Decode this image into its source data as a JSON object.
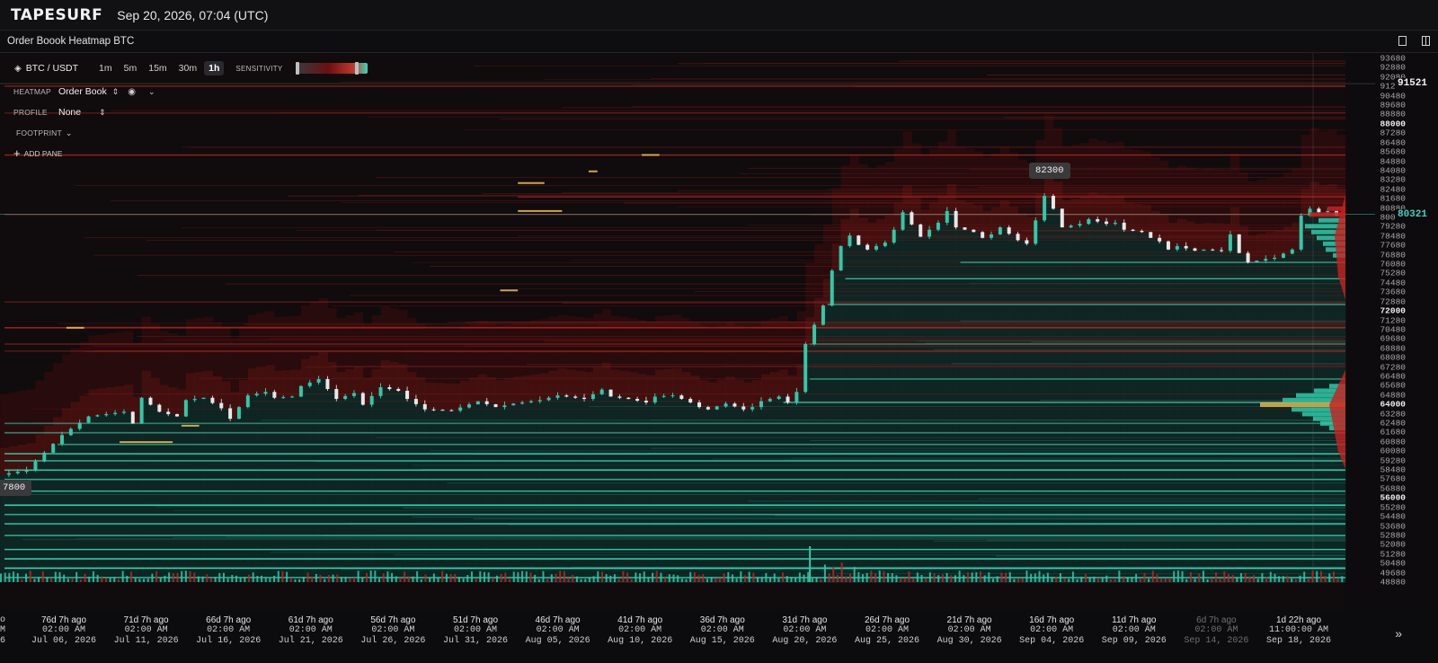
{
  "app": {
    "logo": "TAPESURF",
    "datetime": "Sep 20, 2026, 07:04 (UTC)"
  },
  "panel": {
    "title": "Order Boook Heatmap BTC",
    "icons": [
      "square-icon",
      "columns-icon"
    ]
  },
  "toolbar": {
    "pair": "BTC / USDT",
    "timeframes": [
      "1m",
      "5m",
      "15m",
      "30m",
      "1h"
    ],
    "active_timeframe": "1h",
    "sensitivity_label": "SENSITIVITY",
    "sensitivity_level": 0.85
  },
  "side_menu": {
    "heatmap_label": "HEATMAP",
    "heatmap_value": "Order Book",
    "profile_label": "PROFILE",
    "profile_value": "None",
    "footprint_label": "FOOTPRINT",
    "add_pane_label": "ADD PANE"
  },
  "callouts": {
    "high": "82300",
    "low": "7800"
  },
  "colors": {
    "bid": "#2fd1b0",
    "ask": "#c8201e",
    "accent_yellow": "#e8b44a",
    "current_price": "#3fd3c0",
    "background": "#0d0b0d"
  },
  "chart_data": {
    "type": "heatmap",
    "title": "",
    "price_range": [
      48800,
      93680
    ],
    "price_ticks": [
      "93680",
      "92880",
      "92080",
      "91280",
      "90480",
      "89680",
      "88880",
      "88080",
      "87280",
      "86480",
      "85680",
      "84880",
      "84080",
      "83280",
      "82480",
      "81680",
      "80880",
      "80080",
      "79280",
      "78480",
      "77680",
      "76880",
      "76080",
      "75280",
      "74480",
      "73680",
      "72880",
      "72080",
      "71280",
      "70480",
      "69680",
      "68880",
      "68080",
      "67280",
      "66480",
      "65680",
      "64880",
      "64080",
      "63280",
      "62480",
      "61680",
      "60880",
      "60080",
      "59280",
      "58480",
      "57680",
      "56880",
      "56080",
      "55280",
      "54480",
      "53680",
      "52880",
      "52080",
      "51280",
      "50480",
      "49680",
      "48880"
    ],
    "bold_ticks": [
      "88000",
      "72000",
      "64000",
      "56000"
    ],
    "current_price": "80321",
    "crosshair_price": "91521",
    "time_labels": [
      {
        "ago": "76d 7h ago",
        "time": "02:00 AM",
        "date": "Jul 06, 2026"
      },
      {
        "ago": "71d 7h ago",
        "time": "02:00 AM",
        "date": "Jul 11, 2026"
      },
      {
        "ago": "66d 7h ago",
        "time": "02:00 AM",
        "date": "Jul 16, 2026"
      },
      {
        "ago": "61d 7h ago",
        "time": "02:00 AM",
        "date": "Jul 21, 2026"
      },
      {
        "ago": "56d 7h ago",
        "time": "02:00 AM",
        "date": "Jul 26, 2026"
      },
      {
        "ago": "51d 7h ago",
        "time": "02:00 AM",
        "date": "Jul 31, 2026"
      },
      {
        "ago": "46d 7h ago",
        "time": "02:00 AM",
        "date": "Aug 05, 2026"
      },
      {
        "ago": "41d 7h ago",
        "time": "02:00 AM",
        "date": "Aug 10, 2026"
      },
      {
        "ago": "36d 7h ago",
        "time": "02:00 AM",
        "date": "Aug 15, 2026"
      },
      {
        "ago": "31d 7h ago",
        "time": "02:00 AM",
        "date": "Aug 20, 2026"
      },
      {
        "ago": "26d 7h ago",
        "time": "02:00 AM",
        "date": "Aug 25, 2026"
      },
      {
        "ago": "21d 7h ago",
        "time": "02:00 AM",
        "date": "Aug 30, 2026"
      },
      {
        "ago": "16d 7h ago",
        "time": "02:00 AM",
        "date": "Sep 04, 2026"
      },
      {
        "ago": "11d 7h ago",
        "time": "02:00 AM",
        "date": "Sep 09, 2026"
      },
      {
        "ago": "6d 7h ago",
        "time": "02:00 AM",
        "date": "Sep 14, 2026"
      },
      {
        "ago": "1d 22h ago",
        "time": "11:00:00 AM",
        "date": "Sep 18, 2026"
      }
    ],
    "edge_labels": [
      "o",
      "M",
      "6"
    ],
    "price_path": [
      [
        0,
        58000
      ],
      [
        3,
        58400
      ],
      [
        7,
        61400
      ],
      [
        10,
        63000
      ],
      [
        14,
        63400
      ],
      [
        15,
        62400
      ],
      [
        16,
        64600
      ],
      [
        18,
        63400
      ],
      [
        20,
        63000
      ],
      [
        21,
        64400
      ],
      [
        23,
        64600
      ],
      [
        25,
        63700
      ],
      [
        26,
        62800
      ],
      [
        28,
        64800
      ],
      [
        30,
        65100
      ],
      [
        31,
        64600
      ],
      [
        33,
        64700
      ],
      [
        34,
        65600
      ],
      [
        36,
        66200
      ],
      [
        38,
        64500
      ],
      [
        40,
        65000
      ],
      [
        41,
        64000
      ],
      [
        43,
        65500
      ],
      [
        45,
        65200
      ],
      [
        46,
        64500
      ],
      [
        48,
        63600
      ],
      [
        51,
        63500
      ],
      [
        54,
        64300
      ],
      [
        56,
        63800
      ],
      [
        58,
        64100
      ],
      [
        61,
        64400
      ],
      [
        63,
        64800
      ],
      [
        66,
        64500
      ],
      [
        67,
        64900
      ],
      [
        68,
        65300
      ],
      [
        69,
        64700
      ],
      [
        71,
        64500
      ],
      [
        73,
        64200
      ],
      [
        74,
        64700
      ],
      [
        76,
        64800
      ],
      [
        78,
        64200
      ],
      [
        79,
        63800
      ],
      [
        80,
        63600
      ],
      [
        82,
        64100
      ],
      [
        84,
        63600
      ],
      [
        85,
        63800
      ],
      [
        86,
        64300
      ],
      [
        88,
        64700
      ],
      [
        89,
        64200
      ],
      [
        90,
        65100
      ],
      [
        91,
        69200
      ],
      [
        93,
        72500
      ],
      [
        94,
        75500
      ],
      [
        95,
        77600
      ],
      [
        96,
        78500
      ],
      [
        97,
        77700
      ],
      [
        98,
        77300
      ],
      [
        100,
        77900
      ],
      [
        101,
        79000
      ],
      [
        102,
        80500
      ],
      [
        104,
        78400
      ],
      [
        106,
        79600
      ],
      [
        107,
        80600
      ],
      [
        108,
        79200
      ],
      [
        110,
        78800
      ],
      [
        111,
        78300
      ],
      [
        112,
        78600
      ],
      [
        113,
        79200
      ],
      [
        115,
        78100
      ],
      [
        116,
        77800
      ],
      [
        117,
        79800
      ],
      [
        118,
        81900
      ],
      [
        119,
        80800
      ],
      [
        120,
        79200
      ],
      [
        122,
        79500
      ],
      [
        123,
        79900
      ],
      [
        125,
        79500
      ],
      [
        126,
        79600
      ],
      [
        127,
        79000
      ],
      [
        129,
        78800
      ],
      [
        130,
        78300
      ],
      [
        131,
        78000
      ],
      [
        132,
        77300
      ],
      [
        133,
        77600
      ],
      [
        135,
        77200
      ],
      [
        136,
        77300
      ],
      [
        138,
        77200
      ],
      [
        139,
        78600
      ],
      [
        140,
        77000
      ],
      [
        141,
        76200
      ],
      [
        143,
        76500
      ],
      [
        144,
        76600
      ],
      [
        146,
        77300
      ],
      [
        147,
        80200
      ],
      [
        148,
        80800
      ],
      [
        149,
        80500
      ],
      [
        150,
        80600
      ],
      [
        151,
        80200
      ]
    ],
    "bid_walls": [
      {
        "price": 62400,
        "start": 0,
        "strength": 0.5
      },
      {
        "price": 61600,
        "start": 0,
        "strength": 0.55
      },
      {
        "price": 60600,
        "start": 6,
        "strength": 0.6
      },
      {
        "price": 59800,
        "start": 0,
        "strength": 0.8
      },
      {
        "price": 59200,
        "start": 0,
        "strength": 0.7
      },
      {
        "price": 58400,
        "start": 0,
        "strength": 0.85
      },
      {
        "price": 57600,
        "start": 0,
        "strength": 0.7
      },
      {
        "price": 56600,
        "start": 0,
        "strength": 0.75
      },
      {
        "price": 55400,
        "start": 0,
        "strength": 0.95
      },
      {
        "price": 54600,
        "start": 0,
        "strength": 0.7
      },
      {
        "price": 53800,
        "start": 0,
        "strength": 0.8
      },
      {
        "price": 52800,
        "start": 0,
        "strength": 0.7
      },
      {
        "price": 51600,
        "start": 0,
        "strength": 0.85
      },
      {
        "price": 50800,
        "start": 0,
        "strength": 0.9
      },
      {
        "price": 50000,
        "start": 0,
        "strength": 0.95
      },
      {
        "price": 49200,
        "start": 0,
        "strength": 0.7
      },
      {
        "price": 64200,
        "start": 88,
        "strength": 0.7
      },
      {
        "price": 66200,
        "start": 91,
        "strength": 0.55
      },
      {
        "price": 69200,
        "start": 91,
        "strength": 0.5
      },
      {
        "price": 72600,
        "start": 93,
        "strength": 0.6
      },
      {
        "price": 74800,
        "start": 95,
        "strength": 0.75
      },
      {
        "price": 76200,
        "start": 108,
        "strength": 0.6
      }
    ],
    "ask_walls": [
      {
        "price": 91300,
        "start": 0,
        "strength": 0.6
      },
      {
        "price": 89000,
        "start": 0,
        "strength": 0.4
      },
      {
        "price": 85400,
        "start": 0,
        "strength": 0.7
      },
      {
        "price": 81800,
        "start": 58,
        "strength": 0.55
      },
      {
        "price": 80300,
        "start": 0,
        "strength": 0.5
      },
      {
        "price": 72800,
        "start": 0,
        "strength": 0.4
      },
      {
        "price": 70600,
        "start": 0,
        "strength": 0.8
      },
      {
        "price": 69200,
        "start": 0,
        "strength": 0.45
      },
      {
        "price": 68600,
        "start": 0,
        "strength": 0.4
      }
    ],
    "highlights": [
      {
        "price": 70600,
        "from": 7,
        "to": 9
      },
      {
        "price": 83000,
        "from": 58,
        "to": 61
      },
      {
        "price": 80600,
        "from": 58,
        "to": 63
      },
      {
        "price": 85400,
        "from": 72,
        "to": 74
      },
      {
        "price": 84000,
        "from": 66,
        "to": 67
      },
      {
        "price": 73800,
        "from": 56,
        "to": 58
      },
      {
        "price": 62200,
        "from": 20,
        "to": 22
      },
      {
        "price": 60800,
        "from": 13,
        "to": 19
      }
    ]
  }
}
